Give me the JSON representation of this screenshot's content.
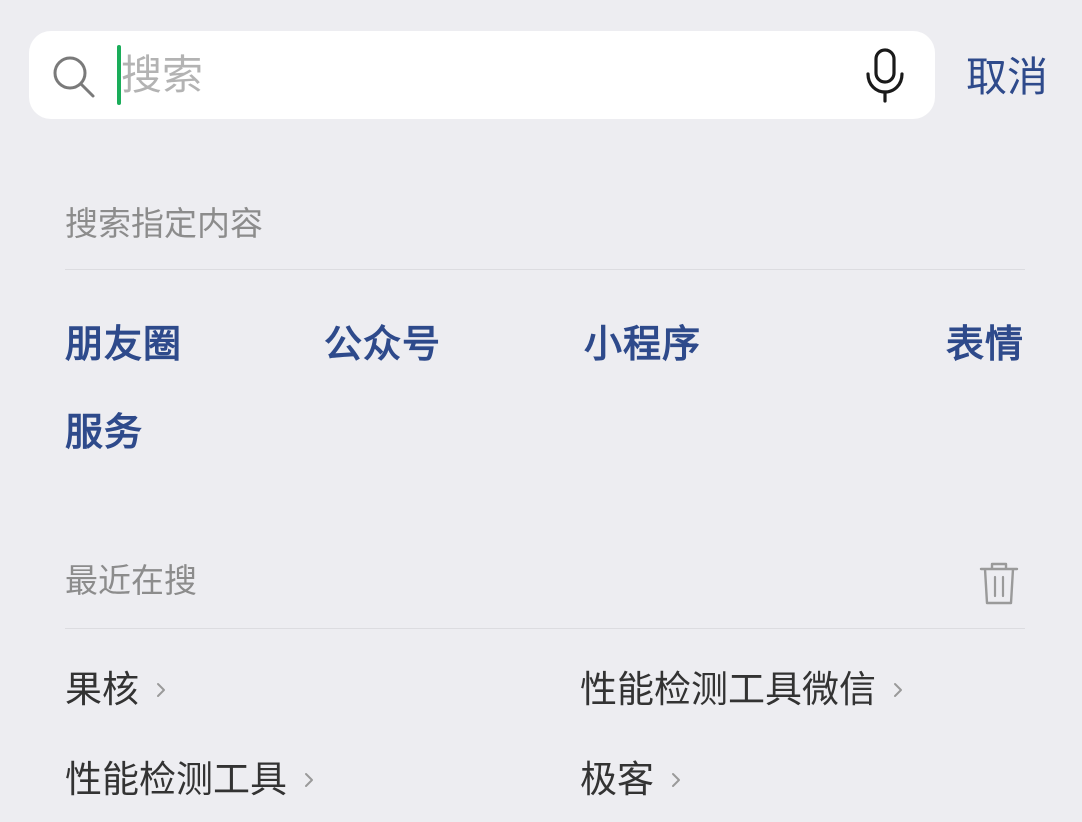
{
  "search": {
    "placeholder": "搜索",
    "value": "",
    "cancel_label": "取消"
  },
  "icons": {
    "search": "search-icon",
    "mic": "microphone-icon",
    "trash": "trash-icon",
    "chevron": "chevron-right-icon"
  },
  "specified": {
    "title": "搜索指定内容",
    "items": [
      {
        "label": "朋友圈"
      },
      {
        "label": "公众号"
      },
      {
        "label": "小程序"
      },
      {
        "label": "表情"
      },
      {
        "label": "服务"
      }
    ]
  },
  "recent": {
    "title": "最近在搜",
    "items": [
      {
        "label": "果核"
      },
      {
        "label": "性能检测工具微信"
      },
      {
        "label": "性能检测工具"
      },
      {
        "label": "极客"
      }
    ]
  },
  "colors": {
    "accent": "#2e4a8b",
    "caret": "#1aad5a",
    "background": "#ededf1"
  }
}
